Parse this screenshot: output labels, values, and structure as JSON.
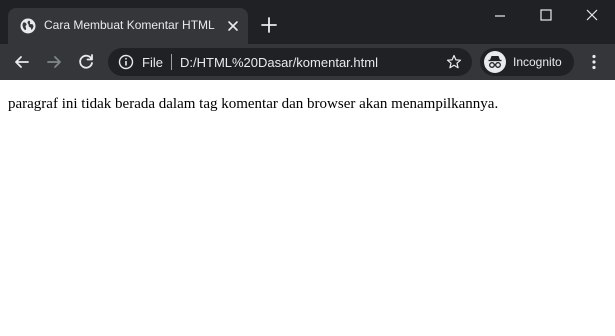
{
  "tab": {
    "title": "Cara Membuat Komentar HTML",
    "favicon": "globe-icon"
  },
  "address_bar": {
    "scheme_label": "File",
    "url": "D:/HTML%20Dasar/komentar.html"
  },
  "profile": {
    "label": "Incognito"
  },
  "page": {
    "paragraph": "paragraf ini tidak berada dalam tag komentar dan browser akan menampilkannya."
  },
  "colors": {
    "titlebar": "#202124",
    "toolbar": "#35363a",
    "omnibox": "#202124",
    "text_light": "#e8eaed",
    "page_background": "#ffffff"
  }
}
